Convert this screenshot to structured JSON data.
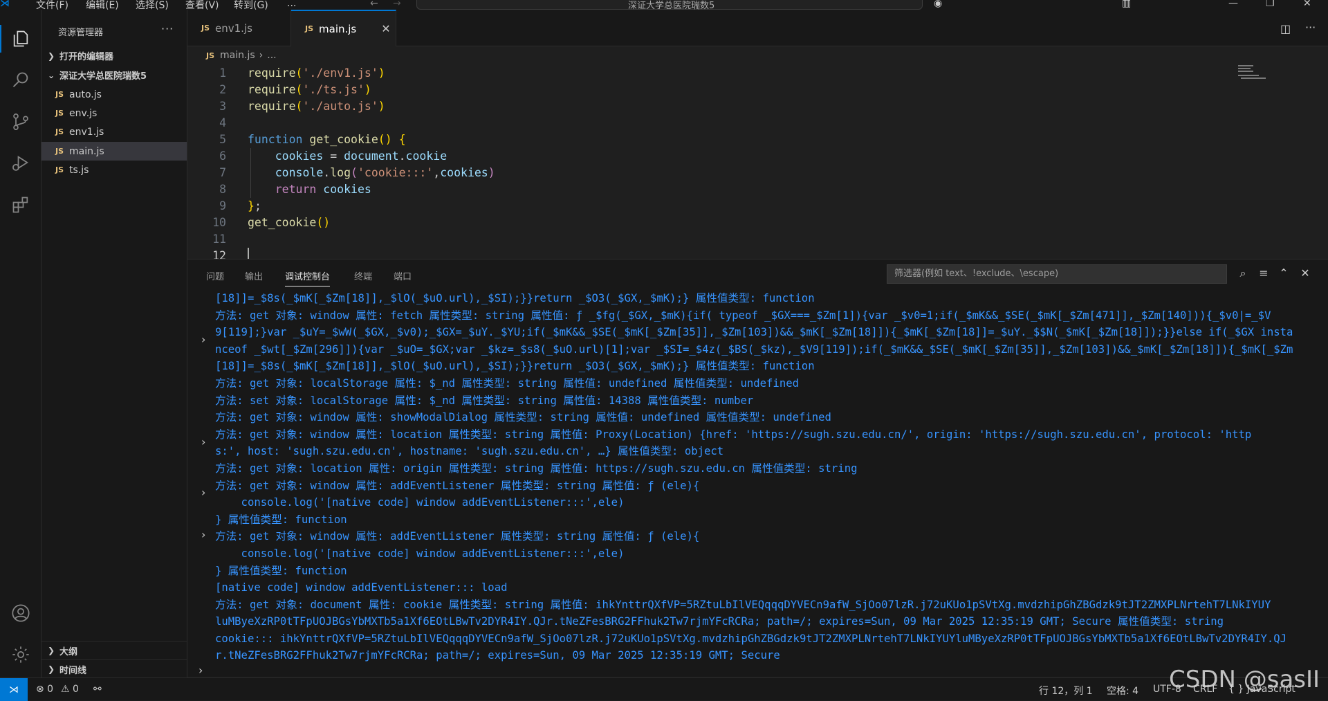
{
  "titlebar": {
    "menus": [
      "文件(F)",
      "编辑(E)",
      "选择(S)",
      "查看(V)",
      "转到(G)",
      "..."
    ],
    "search_text": "深证大学总医院瑞数5"
  },
  "activity": [
    "explorer-icon",
    "search-icon",
    "source-control-icon",
    "run-debug-icon",
    "extensions-icon",
    "account-icon",
    "settings-gear-icon"
  ],
  "sidebar": {
    "title": "资源管理器",
    "more": "···",
    "open_editors": "打开的编辑器",
    "folder": "深证大学总医院瑞数5",
    "files": [
      "auto.js",
      "env.js",
      "env1.js",
      "main.js",
      "ts.js"
    ],
    "selected": "main.js",
    "outline": "大纲",
    "timeline": "时间线"
  },
  "tabs": [
    {
      "label": "env1.js",
      "badge": "JS"
    },
    {
      "label": "main.js",
      "badge": "JS",
      "close": "✕"
    }
  ],
  "breadcrumb": {
    "file": "main.js",
    "sep": "›",
    "rest": "..."
  },
  "editor": {
    "lines": [
      "require('./env1.js')",
      "require('./ts.js')",
      "require('./auto.js')",
      "",
      "function get_cookie() {",
      "    cookies = document.cookie",
      "    console.log('cookie:::',cookies)",
      "    return cookies",
      "};",
      "get_cookie()",
      "",
      ""
    ],
    "current_line": 12
  },
  "panel": {
    "tabs": [
      "问题",
      "输出",
      "调试控制台",
      "终端",
      "端口"
    ],
    "active_tab": "调试控制台",
    "filter_placeholder": "筛选器(例如 text、!exclude、\\escape)",
    "console_lines": [
      "[18]]=_$8s(_$mK[_$Zm[18]],_$lO(_$uO.url),_$SI);}}return _$O3(_$GX,_$mK);} 属性值类型: function",
      "方法: get 对象: window 属性: fetch 属性类型: string 属性值: ƒ _$fg(_$GX,_$mK){if( typeof _$GX===_$Zm[1]){var _$v0=1;if(_$mK&&_$SE(_$mK[_$Zm[471]],_$Zm[140])){_$v0|=_$V",
      "9[119];}var _$uY=_$wW(_$GX,_$v0);_$GX=_$uY._$YU;if(_$mK&&_$SE(_$mK[_$Zm[35]],_$Zm[103])&&_$mK[_$Zm[18]]){_$mK[_$Zm[18]]=_$uY._$$N(_$mK[_$Zm[18]]);}}else if(_$GX insta",
      "nceof _$wt[_$Zm[296]]){var _$uO=_$GX;var _$kz=_$s8(_$uO.url)[1];var _$SI=_$4z(_$BS(_$kz),_$V9[119]);if(_$mK&&_$SE(_$mK[_$Zm[35]],_$Zm[103])&&_$mK[_$Zm[18]]){_$mK[_$Zm",
      "[18]]=_$8s(_$mK[_$Zm[18]],_$lO(_$uO.url),_$SI);}}return _$O3(_$GX,_$mK);} 属性值类型: function",
      "方法: get 对象: localStorage 属性: $_nd 属性类型: string 属性值: undefined 属性值类型: undefined",
      "方法: set 对象: localStorage 属性: $_nd 属性类型: string 属性值: 14388 属性值类型: number",
      "方法: get 对象: window 属性: showModalDialog 属性类型: string 属性值: undefined 属性值类型: undefined",
      "方法: get 对象: window 属性: location 属性类型: string 属性值: Proxy(Location) {href: 'https://sugh.szu.edu.cn/', origin: 'https://sugh.szu.edu.cn', protocol: 'http",
      "s:', host: 'sugh.szu.edu.cn', hostname: 'sugh.szu.edu.cn', …} 属性值类型: object",
      "方法: get 对象: location 属性: origin 属性类型: string 属性值: https://sugh.szu.edu.cn 属性值类型: string",
      "方法: get 对象: window 属性: addEventListener 属性类型: string 属性值: ƒ (ele){",
      "    console.log('[native code] window addEventListener:::',ele)",
      "} 属性值类型: function",
      "方法: get 对象: window 属性: addEventListener 属性类型: string 属性值: ƒ (ele){",
      "    console.log('[native code] window addEventListener:::',ele)",
      "} 属性值类型: function",
      "[native code] window addEventListener::: load",
      "方法: get 对象: document 属性: cookie 属性类型: string 属性值: ihkYnttrQXfVP=5RZtuLbIlVEQqqqDYVECn9afW_SjOo07lzR.j72uKUo1pSVtXg.mvdzhipGhZBGdzk9tJT2ZMXPLNrtehT7LNkIYUY",
      "luMByeXzRP0tTFpUOJBGsYbMXTb5a1Xf6EOtLBwTv2DYR4IY.QJr.tNeZFesBRG2FFhuk2Tw7rjmYFcRCRa; path=/; expires=Sun, 09 Mar 2025 12:35:19 GMT; Secure 属性值类型: string",
      "cookie::: ihkYnttrQXfVP=5RZtuLbIlVEQqqqDYVECn9afW_SjOo07lzR.j72uKUo1pSVtXg.mvdzhipGhZBGdzk9tJT2ZMXPLNrtehT7LNkIYUYluMByeXzRP0tTFpUOJBGsYbMXTb5a1Xf6EOtLBwTv2DYR4IY.QJ",
      "r.tNeZFesBRG2FFhuk2Tw7rjmYFcRCRa; path=/; expires=Sun, 09 Mar 2025 12:35:19 GMT; Secure"
    ],
    "expand_glyph": "›",
    "prompt_glyph": "›"
  },
  "statusbar": {
    "remote": "⋊",
    "errors": "⊗ 0",
    "warnings": "⚠ 0",
    "position": "行 12，列 1",
    "spaces": "空格: 4",
    "encoding": "UTF-8",
    "eol": "CRLF",
    "language": "{ } JavaScript"
  },
  "watermark": "CSDN @sasⅠⅠ"
}
